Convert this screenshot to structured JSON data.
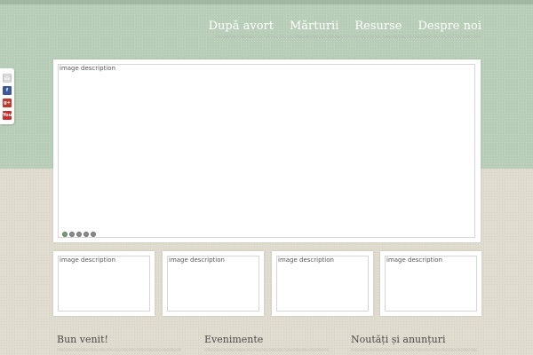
{
  "nav": {
    "items": [
      {
        "label": "După avort"
      },
      {
        "label": "Mărturii"
      },
      {
        "label": "Resurse"
      },
      {
        "label": "Despre noi"
      }
    ]
  },
  "social": {
    "icons": [
      {
        "icon": "mail-icon"
      },
      {
        "icon": "facebook-icon",
        "text": "f"
      },
      {
        "icon": "google-plus-icon",
        "text": "g+"
      },
      {
        "icon": "youtube-icon",
        "text": "You"
      }
    ]
  },
  "slider": {
    "image_alt": "image description",
    "dots_count": 5,
    "active_dot": 1
  },
  "thumbnails": [
    {
      "alt": "image description"
    },
    {
      "alt": "image description"
    },
    {
      "alt": "image description"
    },
    {
      "alt": "image description"
    }
  ],
  "sections": [
    {
      "title": "Bun venit!"
    },
    {
      "title": "Evenimente"
    },
    {
      "title": "Noutăți și anunțuri"
    }
  ],
  "colors": {
    "header_green": "#b8cdb8",
    "page_beige": "#e1dcd0",
    "nav_text": "#ffffff"
  }
}
